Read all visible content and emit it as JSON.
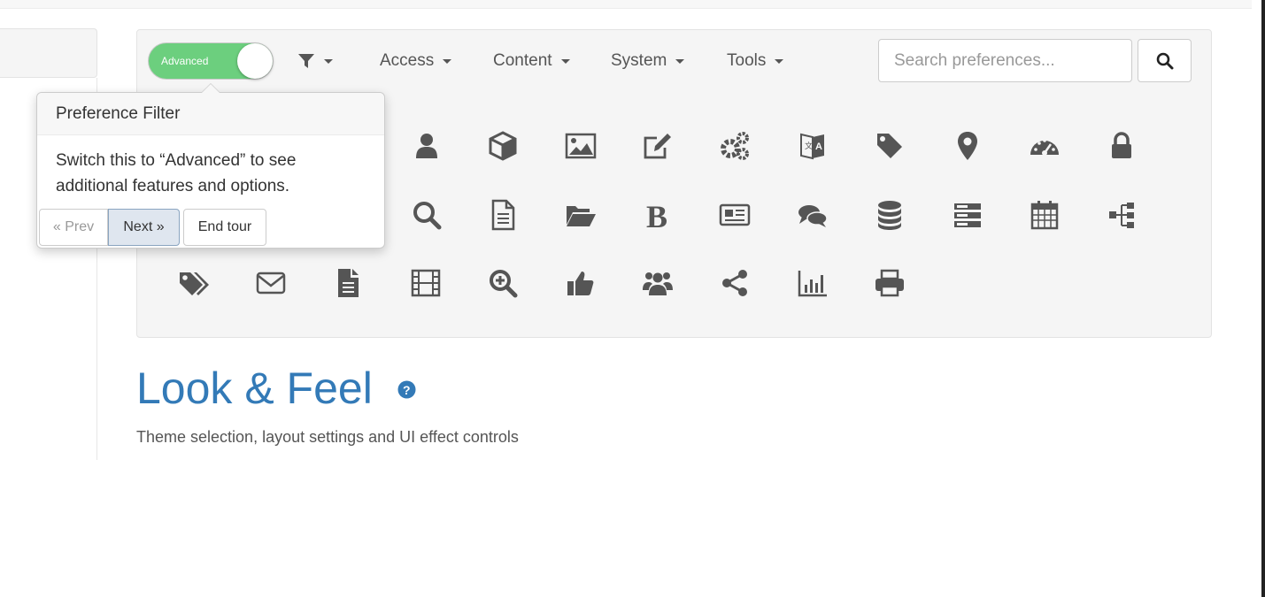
{
  "toolbar": {
    "toggle_label": "Advanced",
    "menus": [
      {
        "label": "Access"
      },
      {
        "label": "Content"
      },
      {
        "label": "System"
      },
      {
        "label": "Tools"
      }
    ],
    "search_placeholder": "Search preferences..."
  },
  "popover": {
    "title": "Preference Filter",
    "content": "Switch this to “Advanced” to see additional features and options.",
    "prev_label": "« Prev",
    "next_label": "Next »",
    "end_label": "End tour"
  },
  "section": {
    "title": "Look & Feel",
    "description": "Theme selection, layout settings and UI effect controls"
  },
  "icons": {
    "row1": [
      "user-icon",
      "cube-icon",
      "image-icon",
      "edit-icon",
      "cogs-icon",
      "translate-icon",
      "tag-icon",
      "map-marker-icon",
      "dashboard-icon",
      "lock-icon"
    ],
    "row2": [
      "search-icon",
      "file-text-icon",
      "folder-open-icon",
      "bold-icon",
      "newspaper-icon",
      "comments-icon",
      "database-icon",
      "server-icon",
      "calendar-icon",
      "sitemap-icon"
    ],
    "row3": [
      "tags-icon",
      "envelope-icon",
      "file-icon",
      "film-icon",
      "zoom-in-icon",
      "thumbs-up-icon",
      "users-icon",
      "share-icon",
      "bar-chart-icon",
      "print-icon"
    ]
  },
  "colors": {
    "toggle_on": "#6ccf7e",
    "heading": "#337ab7",
    "icon": "#555555"
  }
}
